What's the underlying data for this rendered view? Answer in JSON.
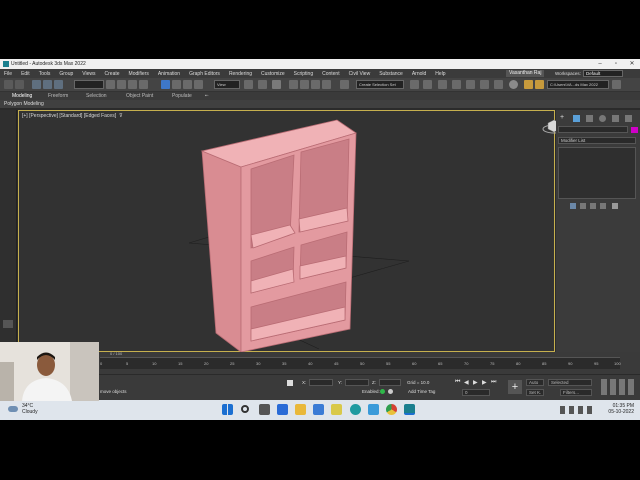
{
  "window": {
    "title": "Untitled - Autodesk 3ds Max 2022"
  },
  "menu": {
    "items": [
      "File",
      "Edit",
      "Tools",
      "Group",
      "Views",
      "Create",
      "Modifiers",
      "Animation",
      "Graph Editors",
      "Rendering",
      "Customize",
      "Scripting",
      "Content",
      "Civil View",
      "Substance",
      "Arnold",
      "Help"
    ],
    "user": "Vasanthan Raj",
    "workspace_label": "Workspaces:",
    "workspace_value": "Default"
  },
  "toolbar": {
    "view_dropdown": "View",
    "selection_set": "Create Selection Set",
    "path": "C:\\Users\\VA...ds Max 2022"
  },
  "ribbon": {
    "tabs": [
      "Modeling",
      "Freeform",
      "Selection",
      "Object Paint",
      "Populate"
    ],
    "active_tab": "Modeling",
    "subpanel": "Polygon Modeling"
  },
  "viewport": {
    "label": "[+] [Perspective] [Standard] [Edged Faces]",
    "object_color": "#e39aa0"
  },
  "command_panel": {
    "modifier_list": "Modifier List"
  },
  "timeline": {
    "ticks": [
      "0",
      "5",
      "10",
      "15",
      "20",
      "25",
      "30",
      "35",
      "40",
      "45",
      "50",
      "55",
      "60",
      "65",
      "70",
      "75",
      "80",
      "85",
      "90",
      "95",
      "100"
    ],
    "frame_display": "0 / 100"
  },
  "status": {
    "message": "move objects",
    "x_label": "X:",
    "y_label": "Y:",
    "z_label": "Z:",
    "grid": "Grid = 10.0",
    "enabled_label": "Enabled:",
    "add_time_tag": "Add Time Tag",
    "auto_label": "Auto",
    "setk_label": "Set K.",
    "selected_label": "Selected",
    "filters_label": "Filters...",
    "frame_value": "0"
  },
  "taskbar": {
    "temperature": "34°C",
    "condition": "Cloudy",
    "time": "01:35 PM",
    "date": "05-10-2022"
  }
}
